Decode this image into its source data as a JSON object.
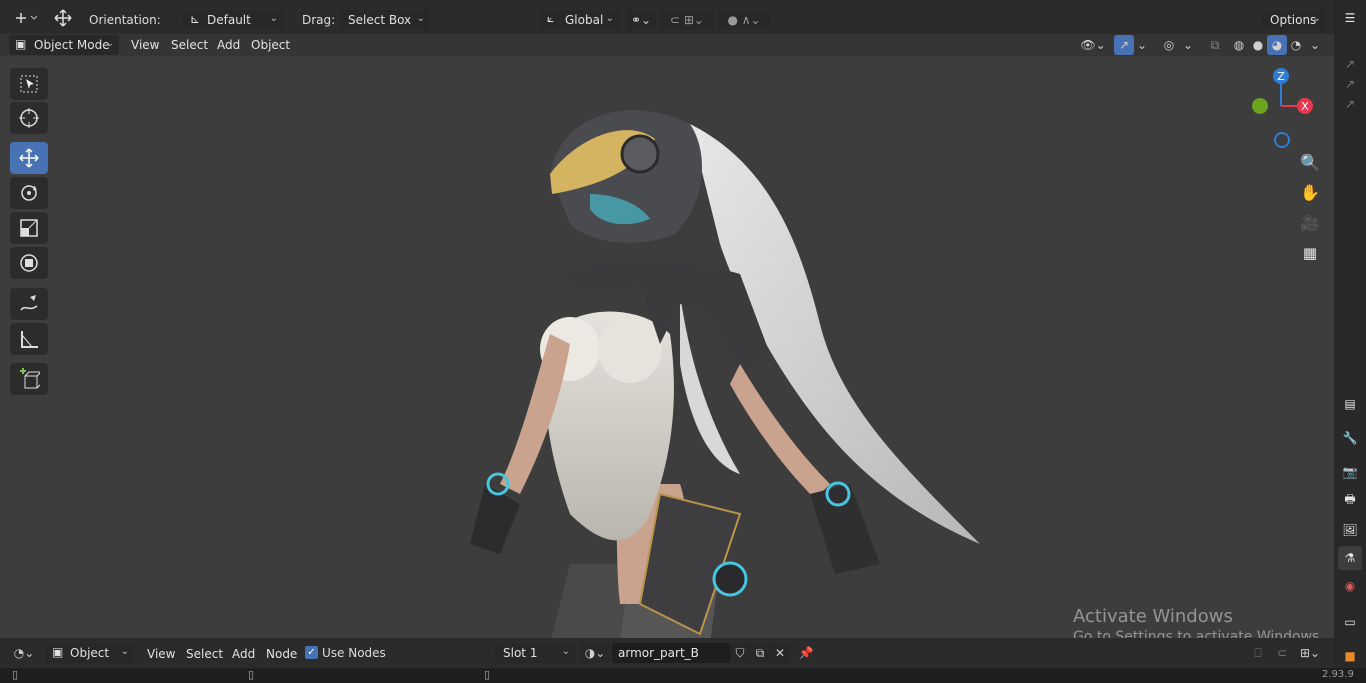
{
  "tool_header": {
    "orientation_label": "Orientation:",
    "orientation_value": "Default",
    "drag_label": "Drag:",
    "drag_value": "Select Box",
    "transform_orientation": "Global",
    "options_label": "Options"
  },
  "view_header": {
    "mode": "Object Mode",
    "menus": [
      "View",
      "Select",
      "Add",
      "Object"
    ]
  },
  "gizmo": {
    "z": "Z",
    "x": "X"
  },
  "node_header": {
    "editor_mode": "Object",
    "menus": [
      "View",
      "Select",
      "Add",
      "Node"
    ],
    "use_nodes_label": "Use Nodes",
    "use_nodes_checked": true,
    "slot": "Slot 1",
    "material_name": "armor_part_B"
  },
  "watermark": {
    "title": "Activate Windows",
    "subtitle": "Go to Settings to activate Windows."
  },
  "status": {
    "version": "2.93.9"
  },
  "colors": {
    "accent": "#4772b3",
    "axis_x": "#e8374f",
    "axis_y": "#6ea31f",
    "axis_z": "#2d7ed4",
    "background": "#3d3d3d"
  }
}
